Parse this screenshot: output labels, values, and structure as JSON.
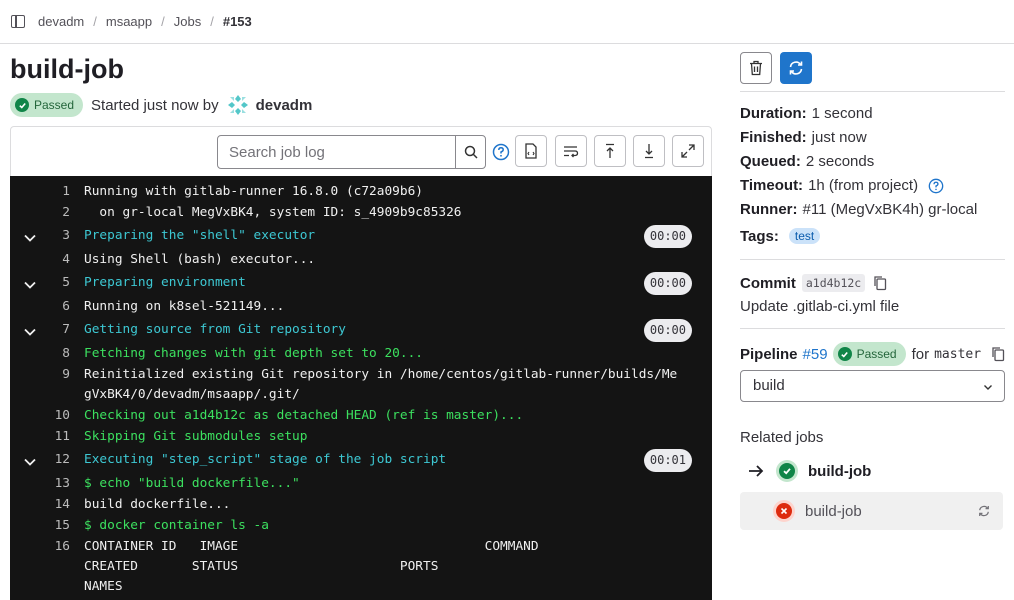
{
  "breadcrumb": [
    "devadm",
    "msaapp",
    "Jobs",
    "#153"
  ],
  "title": "build-job",
  "header": {
    "status_badge": "Passed",
    "started_text": "Started just now by",
    "user": "devadm"
  },
  "toolbar": {
    "search_placeholder": "Search job log"
  },
  "log_lines": [
    {
      "n": "1",
      "text": "Running with gitlab-runner 16.8.0 (c72a09b6)",
      "color": "white"
    },
    {
      "n": "2",
      "text": "  on gr-local MegVxBK4, system ID: s_4909b9c85326",
      "color": "white"
    },
    {
      "n": "3",
      "text": "Preparing the \"shell\" executor",
      "color": "cyan",
      "section": true,
      "time": "00:00"
    },
    {
      "n": "4",
      "text": "Using Shell (bash) executor...",
      "color": "white"
    },
    {
      "n": "5",
      "text": "Preparing environment",
      "color": "cyan",
      "section": true,
      "time": "00:00"
    },
    {
      "n": "6",
      "text": "Running on k8sel-521149...",
      "color": "white"
    },
    {
      "n": "7",
      "text": "Getting source from Git repository",
      "color": "cyan",
      "section": true,
      "time": "00:00"
    },
    {
      "n": "8",
      "text": "Fetching changes with git depth set to 20...",
      "color": "green"
    },
    {
      "n": "9",
      "text": "Reinitialized existing Git repository in /home/centos/gitlab-runner/builds/Me",
      "text2": "gVxBK4/0/devadm/msaapp/.git/",
      "color": "white"
    },
    {
      "n": "10",
      "text": "Checking out a1d4b12c as detached HEAD (ref is master)...",
      "color": "green"
    },
    {
      "n": "11",
      "text": "Skipping Git submodules setup",
      "color": "green"
    },
    {
      "n": "12",
      "text": "Executing \"step_script\" stage of the job script",
      "color": "cyan",
      "section": true,
      "time": "00:01"
    },
    {
      "n": "13",
      "text": "$ echo \"build dockerfile...\"",
      "color": "green"
    },
    {
      "n": "14",
      "text": "build dockerfile...",
      "color": "white"
    },
    {
      "n": "15",
      "text": "$ docker container ls -a",
      "color": "green"
    },
    {
      "n": "16",
      "text": "CONTAINER ID   IMAGE                                COMMAND",
      "text2": "CREATED       STATUS                     PORTS",
      "text3": "NAMES",
      "color": "white"
    }
  ],
  "sidebar": {
    "duration_label": "Duration:",
    "duration": "1 second",
    "finished_label": "Finished:",
    "finished": "just now",
    "queued_label": "Queued:",
    "queued": "2 seconds",
    "timeout_label": "Timeout:",
    "timeout": "1h (from project)",
    "runner_label": "Runner:",
    "runner": "#11 (MegVxBK4h) gr-local",
    "tags_label": "Tags:",
    "tag": "test",
    "commit_label": "Commit",
    "commit_sha": "a1d4b12c",
    "commit_message": "Update .gitlab-ci.yml file",
    "pipeline_label": "Pipeline",
    "pipeline_id": "#59",
    "pipeline_status": "Passed",
    "pipeline_for": "for",
    "pipeline_ref": "master",
    "stage_select": "build",
    "related_title": "Related jobs",
    "related_jobs": [
      {
        "name": "build-job",
        "status": "success",
        "current": true
      },
      {
        "name": "build-job",
        "status": "failed",
        "current": false
      }
    ]
  },
  "colors": {
    "success": "#108548",
    "failed": "#dd2b0e",
    "primary": "#1f75cb",
    "log_bg": "#141414"
  }
}
